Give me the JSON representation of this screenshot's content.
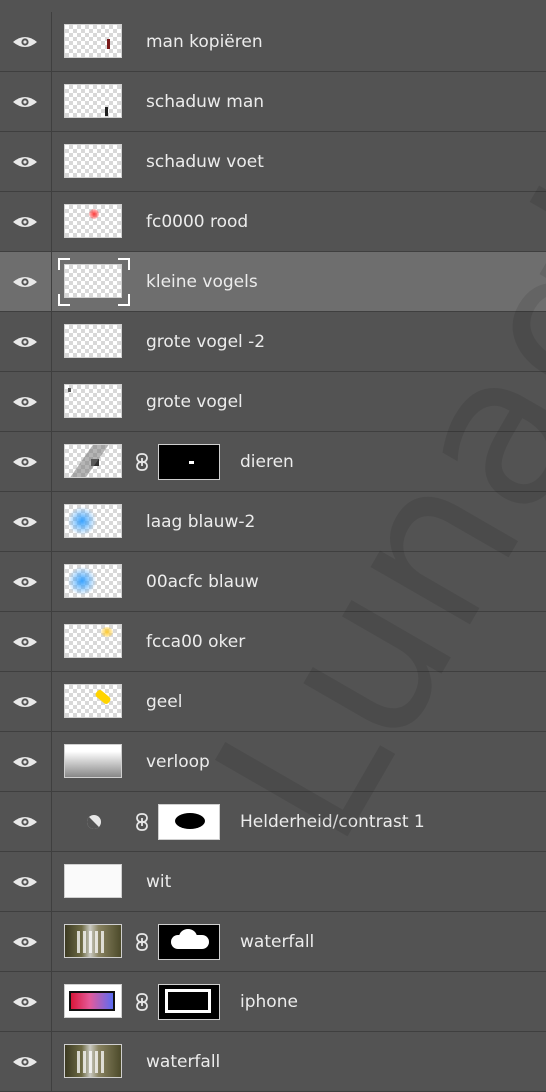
{
  "panel": {
    "name": "layers-panel"
  },
  "layers": [
    {
      "name": "man kopiëren",
      "selected": false,
      "thumb": "transparent-with-small-figure",
      "mask": null
    },
    {
      "name": "schaduw man",
      "selected": false,
      "thumb": "transparent-with-shadow",
      "mask": null
    },
    {
      "name": "schaduw voet",
      "selected": false,
      "thumb": "transparent",
      "mask": null
    },
    {
      "name": "fc0000  rood",
      "selected": false,
      "thumb": "transparent-with-red-dot",
      "mask": null
    },
    {
      "name": "kleine vogels",
      "selected": true,
      "thumb": "transparent",
      "mask": null
    },
    {
      "name": "grote vogel -2",
      "selected": false,
      "thumb": "transparent",
      "mask": null
    },
    {
      "name": "grote vogel",
      "selected": false,
      "thumb": "transparent-with-bird",
      "mask": null
    },
    {
      "name": "dieren",
      "selected": false,
      "thumb": "transparent-with-animals",
      "mask": "black-with-white-spot"
    },
    {
      "name": "laag blauw-2",
      "selected": false,
      "thumb": "transparent-with-blue-glow",
      "mask": null
    },
    {
      "name": "00acfc  blauw",
      "selected": false,
      "thumb": "transparent-with-blue-glow",
      "mask": null
    },
    {
      "name": "fcca00  oker",
      "selected": false,
      "thumb": "transparent-with-ochre-dot",
      "mask": null
    },
    {
      "name": "geel",
      "selected": false,
      "thumb": "transparent-with-yellow-stroke",
      "mask": null
    },
    {
      "name": "verloop",
      "selected": false,
      "thumb": "gradient",
      "mask": null
    },
    {
      "name": "Helderheid/contrast 1",
      "selected": false,
      "thumb": "adjustment-icon",
      "mask": "white-with-black-blob"
    },
    {
      "name": "wit",
      "selected": false,
      "thumb": "white",
      "mask": null
    },
    {
      "name": "waterfall",
      "selected": false,
      "thumb": "waterfall-photo",
      "mask": "black-with-white-cloud"
    },
    {
      "name": "iphone",
      "selected": false,
      "thumb": "iphone-photo",
      "mask": "white-frame"
    },
    {
      "name": "waterfall",
      "selected": false,
      "thumb": "waterfall-photo",
      "mask": null
    }
  ],
  "colors": {
    "panel_bg": "#535353",
    "selected_bg": "#6e6e6e",
    "text": "#ececec",
    "divider": "#3f3f3f"
  },
  "watermark": {
    "text": "Lunagiro"
  }
}
